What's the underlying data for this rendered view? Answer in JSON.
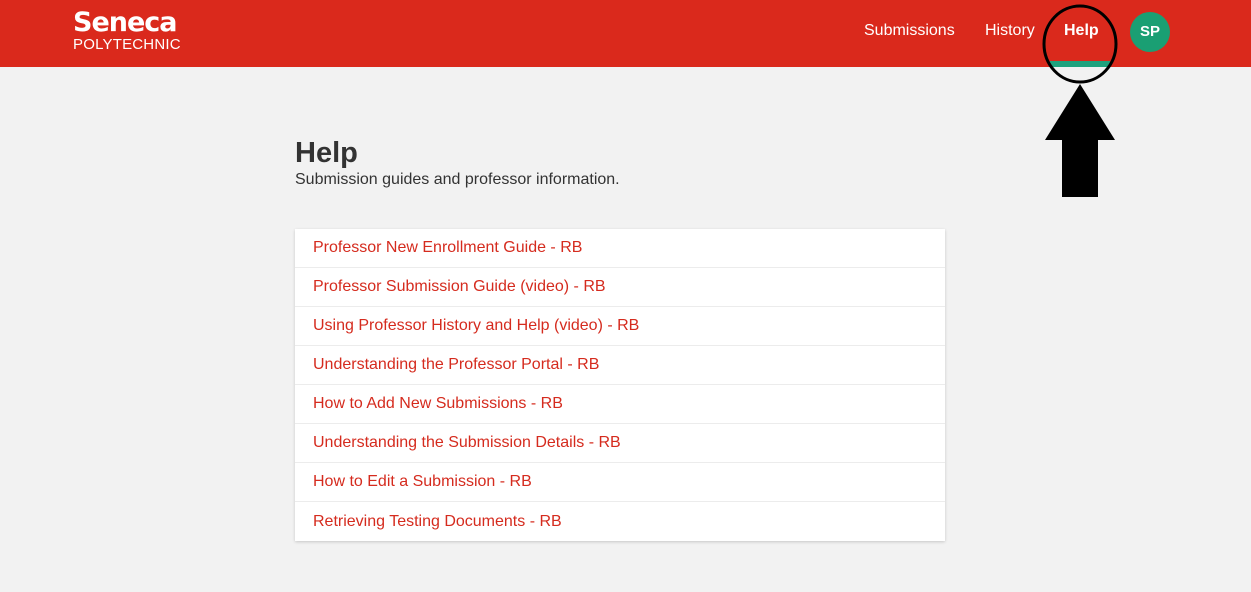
{
  "header": {
    "logo_name": "Seneca",
    "logo_sub": "POLYTECHNIC",
    "nav": {
      "submissions": "Submissions",
      "history": "History",
      "help": "Help"
    },
    "avatar_initials": "SP",
    "colors": {
      "bar": "#da291c",
      "active_indicator": "#1fa27e",
      "avatar": "#1a9f73"
    }
  },
  "main": {
    "title": "Help",
    "subtitle": "Submission guides and professor information.",
    "guides": [
      "Professor New Enrollment Guide - RB",
      "Professor Submission Guide (video) - RB",
      "Using Professor History and Help (video) - RB",
      "Understanding the Professor Portal - RB",
      "How to Add New Submissions - RB",
      "Understanding the Submission Details - RB",
      "How to Edit a Submission - RB",
      "Retrieving Testing Documents - RB"
    ]
  },
  "annotation": {
    "shapes": [
      "circle-outline",
      "up-arrow-icon"
    ],
    "color": "#000000"
  }
}
